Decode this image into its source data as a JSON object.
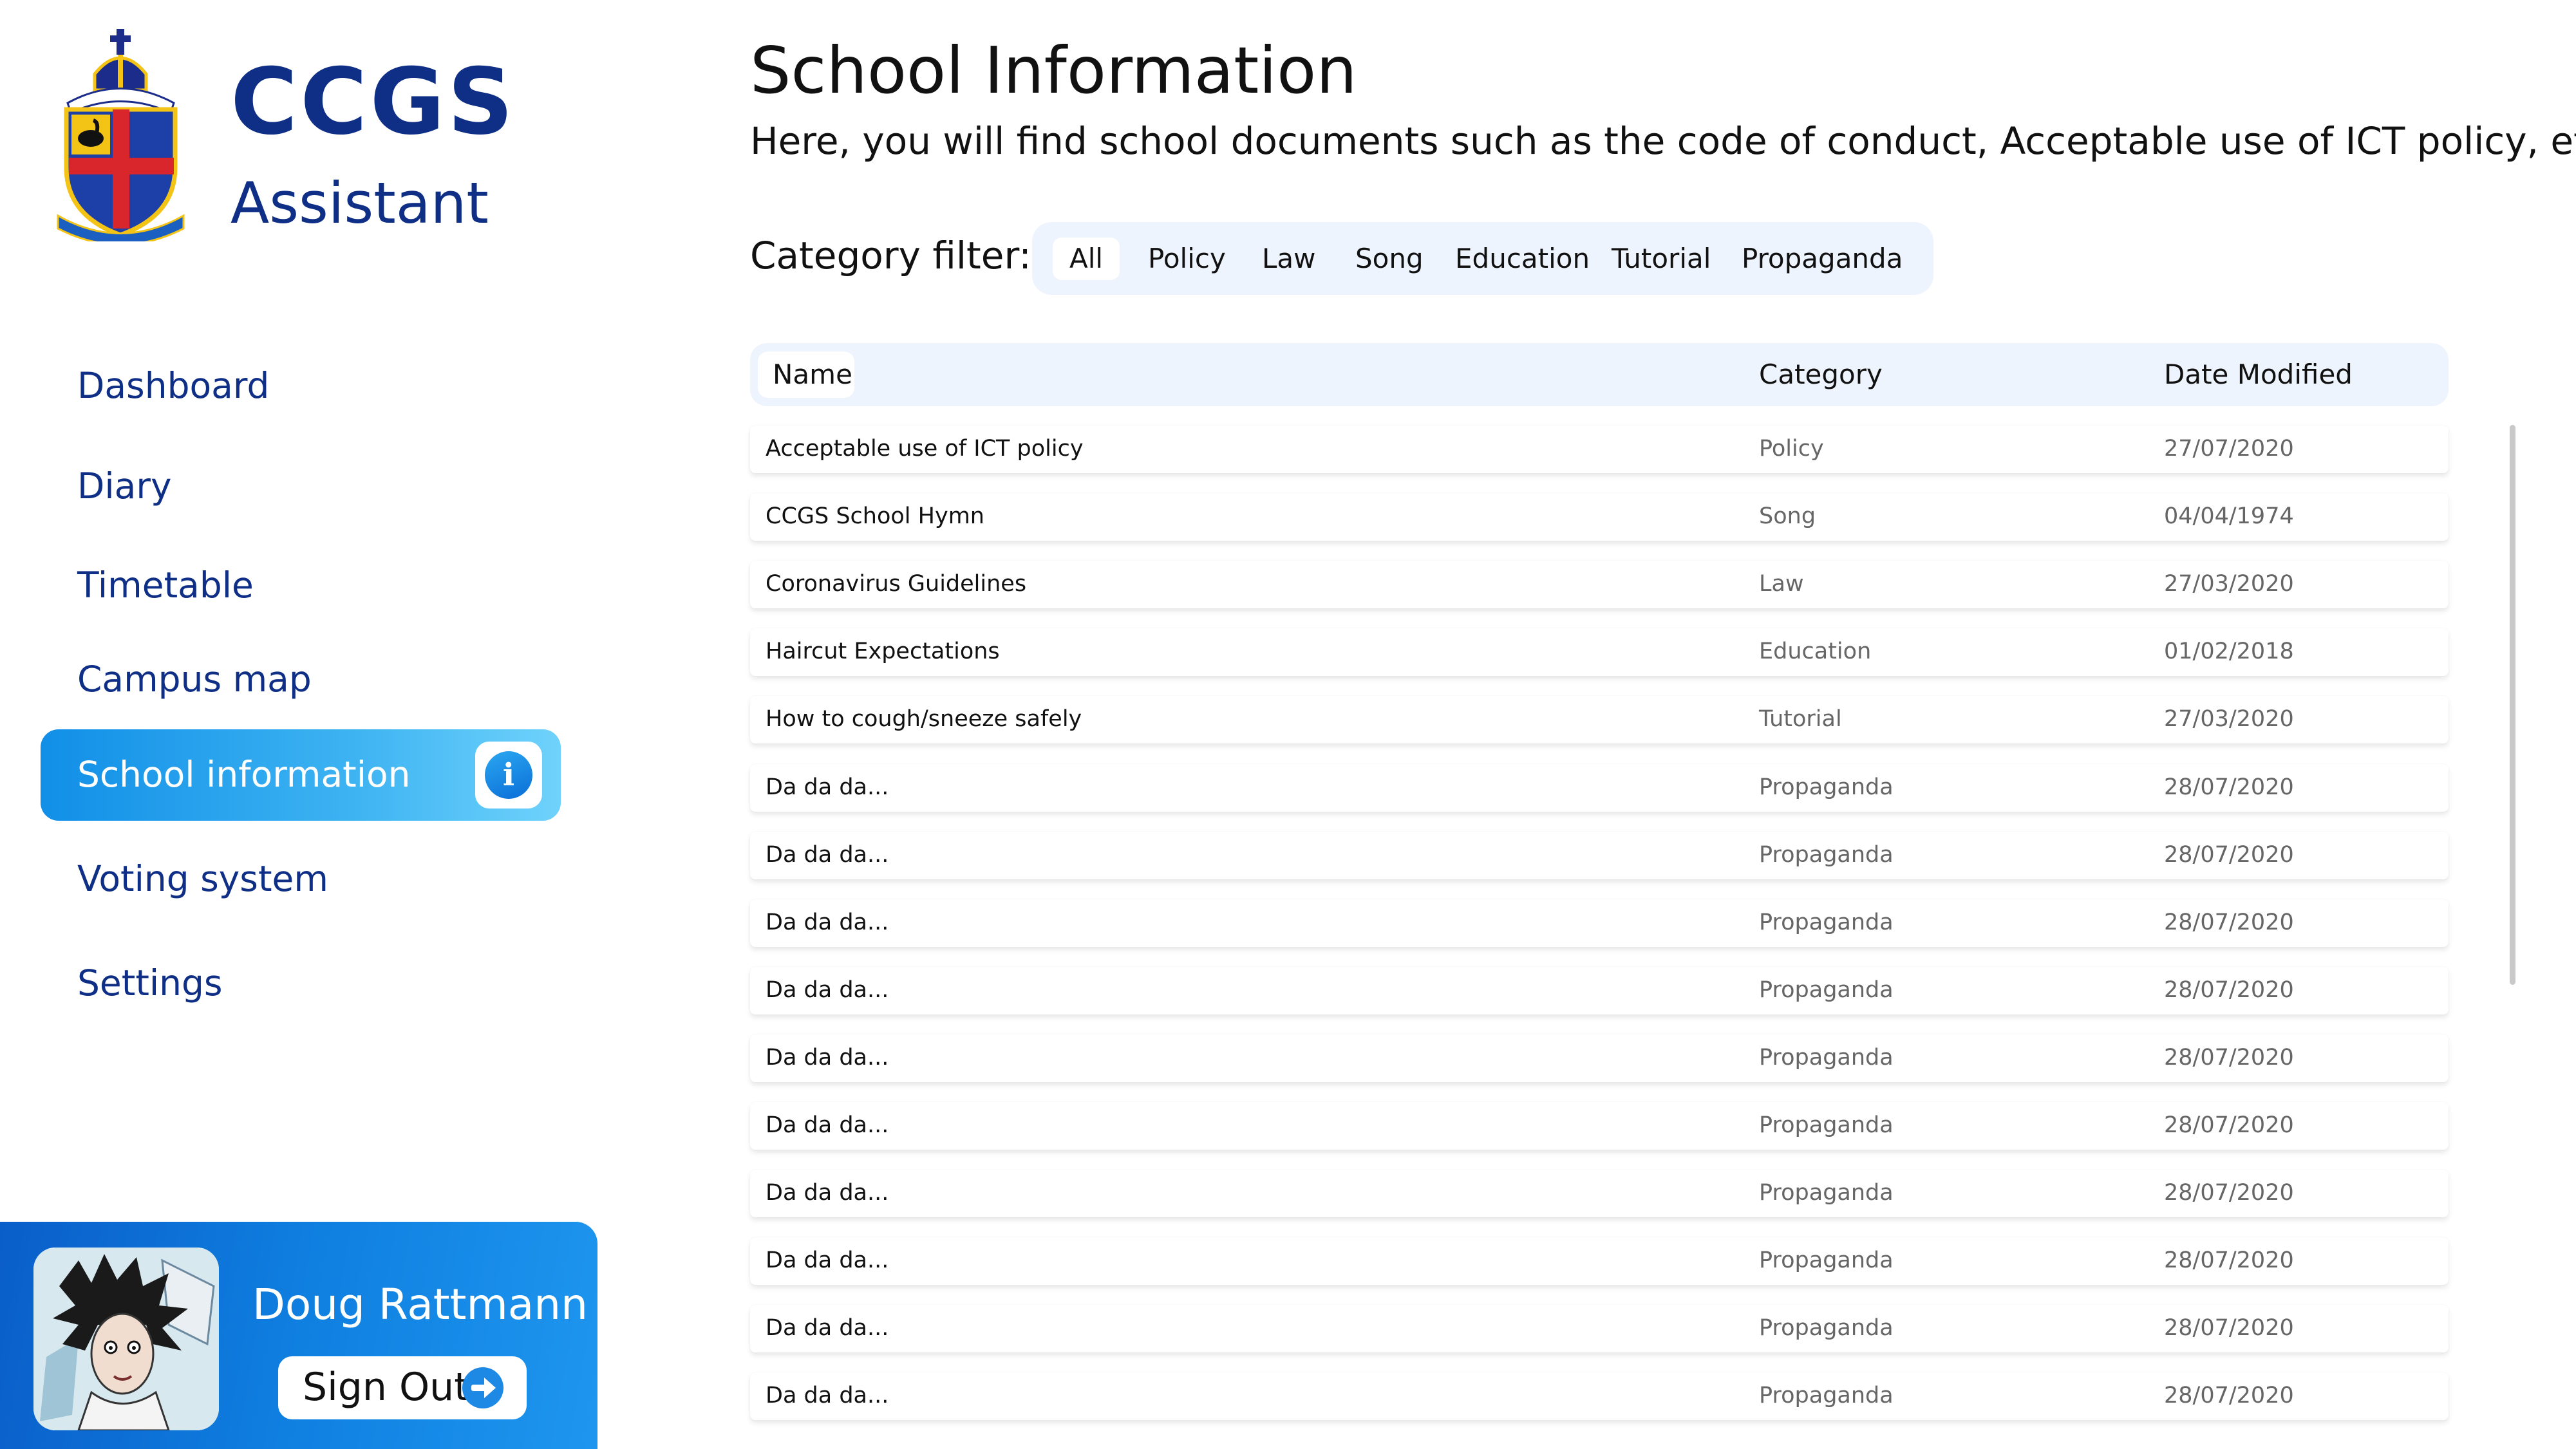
{
  "brand": {
    "line1": "CCGS",
    "line2": "Assistant"
  },
  "sidebar": {
    "items": [
      {
        "label": "Dashboard",
        "active": false
      },
      {
        "label": "Diary",
        "active": false
      },
      {
        "label": "Timetable",
        "active": false
      },
      {
        "label": "Campus map",
        "active": false
      },
      {
        "label": "School information",
        "active": true,
        "icon": "info-icon"
      },
      {
        "label": "Voting system",
        "active": false
      },
      {
        "label": "Settings",
        "active": false
      }
    ]
  },
  "user": {
    "name": "Doug Rattmann",
    "signout_label": "Sign Out",
    "signout_icon": "arrow-right-circle-icon"
  },
  "page": {
    "title": "School Information",
    "description": "Here, you will find school documents such as the code of conduct, Acceptable use of ICT policy, etc."
  },
  "filter": {
    "label": "Category filter:",
    "options": [
      "All",
      "Policy",
      "Law",
      "Song",
      "Education",
      "Tutorial",
      "Propaganda"
    ],
    "selected": "All"
  },
  "table": {
    "columns": [
      "Name",
      "Category",
      "Date Modified"
    ],
    "rows": [
      {
        "name": "Acceptable use of ICT policy",
        "category": "Policy",
        "date": "27/07/2020"
      },
      {
        "name": "CCGS School Hymn",
        "category": "Song",
        "date": "04/04/1974"
      },
      {
        "name": "Coronavirus Guidelines",
        "category": "Law",
        "date": "27/03/2020"
      },
      {
        "name": "Haircut Expectations",
        "category": "Education",
        "date": "01/02/2018"
      },
      {
        "name": "How to cough/sneeze safely",
        "category": "Tutorial",
        "date": "27/03/2020"
      },
      {
        "name": "Da da da...",
        "category": "Propaganda",
        "date": "28/07/2020"
      },
      {
        "name": "Da da da...",
        "category": "Propaganda",
        "date": "28/07/2020"
      },
      {
        "name": "Da da da...",
        "category": "Propaganda",
        "date": "28/07/2020"
      },
      {
        "name": "Da da da...",
        "category": "Propaganda",
        "date": "28/07/2020"
      },
      {
        "name": "Da da da...",
        "category": "Propaganda",
        "date": "28/07/2020"
      },
      {
        "name": "Da da da...",
        "category": "Propaganda",
        "date": "28/07/2020"
      },
      {
        "name": "Da da da...",
        "category": "Propaganda",
        "date": "28/07/2020"
      },
      {
        "name": "Da da da...",
        "category": "Propaganda",
        "date": "28/07/2020"
      },
      {
        "name": "Da da da...",
        "category": "Propaganda",
        "date": "28/07/2020"
      },
      {
        "name": "Da da da...",
        "category": "Propaganda",
        "date": "28/07/2020"
      }
    ]
  },
  "colors": {
    "brand_navy": "#0f2f86",
    "accent_blue": "#118fe7",
    "panel_bg": "#eef4fd",
    "muted_text": "#666666"
  }
}
